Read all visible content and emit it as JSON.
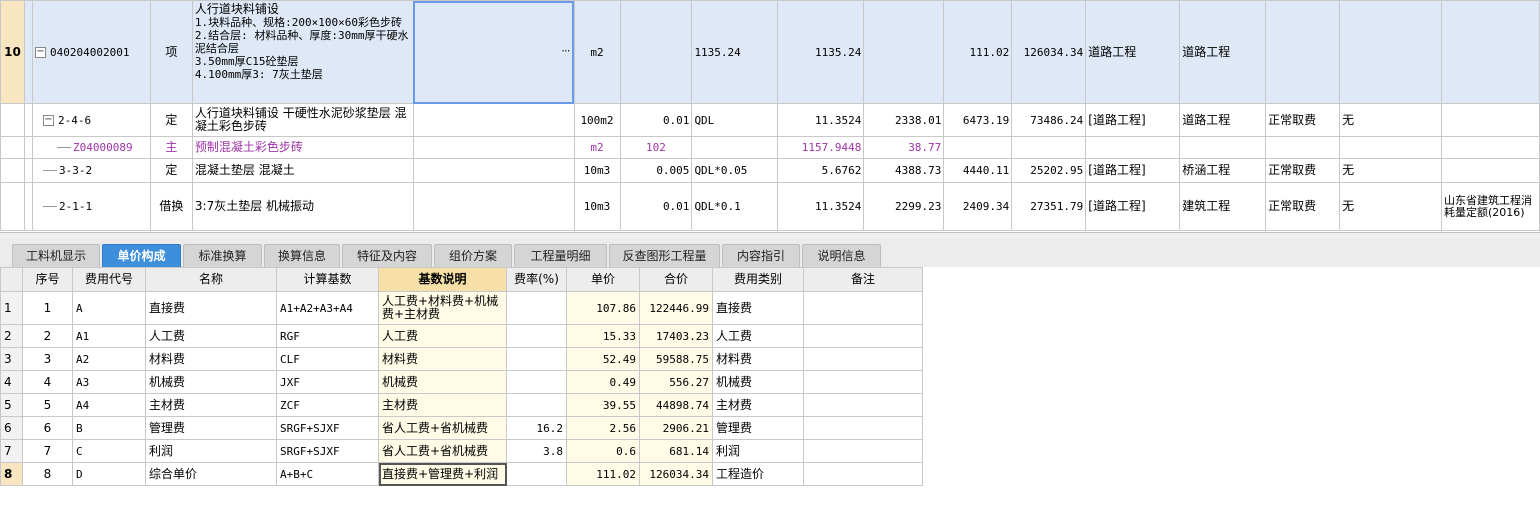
{
  "top_grid": {
    "rows": [
      {
        "rownum": "10",
        "code": "040204002001",
        "type": "项",
        "name_lines": [
          "人行道块料铺设",
          "1.块料品种、规格:200×100×60彩色步砖",
          "2.结合层: 材料品种、厚度:30mm厚干硬水泥结合层",
          "3.50mm厚C15砼垫层",
          "4.100mm厚3: 7灰土垫层"
        ],
        "expr": "···",
        "unit": "m2",
        "qty_expr": "",
        "qty_formula": "1135.24",
        "qty": "1135.24",
        "c9": "",
        "unit_price": "111.02",
        "total": "126034.34",
        "specialty": "道路工程",
        "category": "道路工程",
        "fee": "",
        "flag": "",
        "ref": ""
      },
      {
        "rownum": "",
        "code": "2-4-6",
        "type": "定",
        "name_lines": [
          "人行道块料铺设 干硬性水泥砂浆垫层 混凝土彩色步砖"
        ],
        "expr": "",
        "unit": "100m2",
        "qty_expr": "0.01",
        "qty_formula": "QDL",
        "qty": "11.3524",
        "c9": "2338.01",
        "unit_price": "6473.19",
        "total": "73486.24",
        "specialty": "[道路工程]",
        "category": "道路工程",
        "fee": "正常取费",
        "flag": "无",
        "ref": ""
      },
      {
        "rownum": "",
        "code": "Z04000089",
        "type": "主",
        "name_lines": [
          "预制混凝土彩色步砖"
        ],
        "expr": "",
        "unit": "m2",
        "qty_expr": "102",
        "qty_formula": "",
        "qty": "1157.9448",
        "c9": "38.77",
        "unit_price": "",
        "total": "",
        "specialty": "",
        "category": "",
        "fee": "",
        "flag": "",
        "ref": ""
      },
      {
        "rownum": "",
        "code": "3-3-2",
        "type": "定",
        "name_lines": [
          "混凝土垫层 混凝土"
        ],
        "expr": "",
        "unit": "10m3",
        "qty_expr": "0.005",
        "qty_formula": "QDL*0.05",
        "qty": "5.6762",
        "c9": "4388.73",
        "unit_price": "4440.11",
        "total": "25202.95",
        "specialty": "[道路工程]",
        "category": "桥涵工程",
        "fee": "正常取费",
        "flag": "无",
        "ref": ""
      },
      {
        "rownum": "",
        "code": "2-1-1",
        "type": "借换",
        "name_lines": [
          "3:7灰土垫层 机械振动"
        ],
        "expr": "",
        "unit": "10m3",
        "qty_expr": "0.01",
        "qty_formula": "QDL*0.1",
        "qty": "11.3524",
        "c9": "2299.23",
        "unit_price": "2409.34",
        "total": "27351.79",
        "specialty": "[道路工程]",
        "category": "建筑工程",
        "fee": "正常取费",
        "flag": "无",
        "ref": "山东省建筑工程消耗量定额(2016)"
      }
    ]
  },
  "tabs": [
    "工料机显示",
    "单价构成",
    "标准换算",
    "换算信息",
    "特征及内容",
    "组价方案",
    "工程量明细",
    "反查图形工程量",
    "内容指引",
    "说明信息"
  ],
  "active_tab": "单价构成",
  "bottom_grid": {
    "headers": [
      "",
      "序号",
      "费用代号",
      "名称",
      "计算基数",
      "基数说明",
      "费率(%)",
      "单价",
      "合价",
      "费用类别",
      "备注"
    ],
    "rows": [
      [
        "1",
        "1",
        "A",
        "直接费",
        "A1+A2+A3+A4",
        "人工费+材料费+机械费+主材费",
        "",
        "107.86",
        "122446.99",
        "直接费",
        ""
      ],
      [
        "2",
        "2",
        "A1",
        "人工费",
        "RGF",
        "人工费",
        "",
        "15.33",
        "17403.23",
        "人工费",
        ""
      ],
      [
        "3",
        "3",
        "A2",
        "材料费",
        "CLF",
        "材料费",
        "",
        "52.49",
        "59588.75",
        "材料费",
        ""
      ],
      [
        "4",
        "4",
        "A3",
        "机械费",
        "JXF",
        "机械费",
        "",
        "0.49",
        "556.27",
        "机械费",
        ""
      ],
      [
        "5",
        "5",
        "A4",
        "主材费",
        "ZCF",
        "主材费",
        "",
        "39.55",
        "44898.74",
        "主材费",
        ""
      ],
      [
        "6",
        "6",
        "B",
        "管理费",
        "SRGF+SJXF",
        "省人工费+省机械费",
        "16.2",
        "2.56",
        "2906.21",
        "管理费",
        ""
      ],
      [
        "7",
        "7",
        "C",
        "利润",
        "SRGF+SJXF",
        "省人工费+省机械费",
        "3.8",
        "0.6",
        "681.14",
        "利润",
        ""
      ],
      [
        "8",
        "8",
        "D",
        "综合单价",
        "A+B+C",
        "直接费+管理费+利润",
        "",
        "111.02",
        "126034.34",
        "工程造价",
        ""
      ]
    ]
  }
}
